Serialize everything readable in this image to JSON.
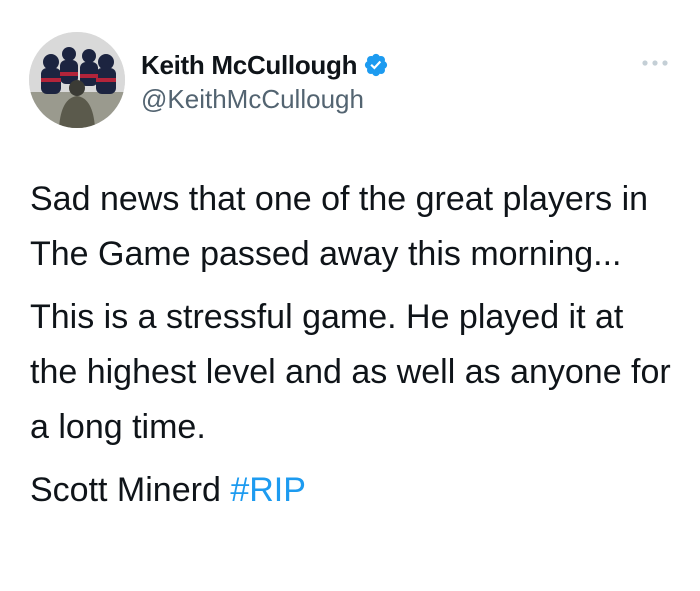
{
  "tweet": {
    "author": {
      "display_name": "Keith McCullough",
      "handle": "@KeithMcCullough",
      "verified": true,
      "avatar_icon": "team-photo-avatar"
    },
    "more_icon": "more-options-icon",
    "paragraphs": [
      {
        "text": "Sad news that one of the great players in The Game passed away this morning..."
      },
      {
        "text": "This is a stressful game. He played it at the highest level and as well as anyone for a long time."
      }
    ],
    "signoff": {
      "text": "Scott Minerd ",
      "hashtag": "#RIP"
    }
  },
  "colors": {
    "text": "#0f1419",
    "secondary": "#536471",
    "accent": "#1d9bf0"
  }
}
